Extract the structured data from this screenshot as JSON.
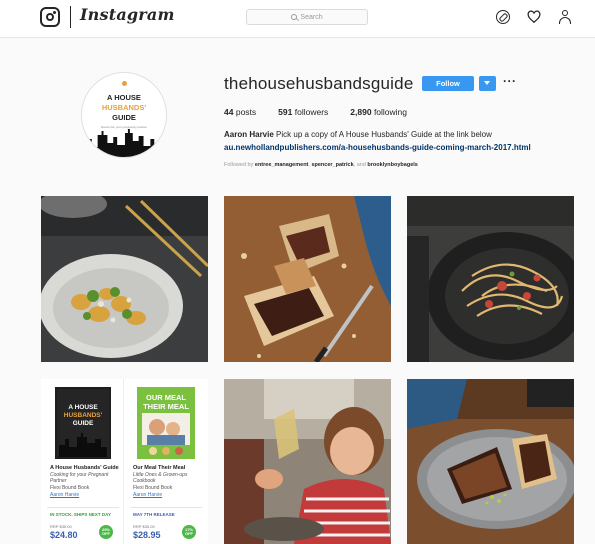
{
  "header": {
    "wordmark": "Instagram",
    "search_placeholder": "Search",
    "icons": [
      "camera-logo-icon",
      "compass-icon",
      "heart-icon",
      "person-icon"
    ]
  },
  "profile": {
    "avatar_text": [
      "A HOUSE",
      "HUSBANDS'",
      "GUIDE"
    ],
    "avatar_small_text": "Dad-to-be: your pregnancy partner",
    "username": "thehousehusbandsguide",
    "follow_label": "Follow",
    "more_label": "···",
    "stats": {
      "posts_count": "44",
      "posts_label": "posts",
      "followers_count": "591",
      "followers_label": "followers",
      "following_count": "2,890",
      "following_label": "following"
    },
    "bio_name": "Aaron Harvie",
    "bio_text": "Pick up a copy of A House Husbands' Guide at the link below",
    "bio_link": "au.newhollandpublishers.com/a-househusbands-guide-coming-march-2017.html",
    "followed_prefix": "Followed by",
    "followed_by": [
      "entree_management",
      "spencer_patrick",
      "brooklynboybagels"
    ],
    "followed_sep": ", ",
    "followed_and": ", and"
  },
  "books": [
    {
      "cover_lines": [
        "A HOUSE",
        "HUSBANDS'",
        "GUIDE"
      ],
      "title": "A House Husbands' Guide",
      "subtitle": "Cooking for your Pregnant Partner",
      "format": "Flexi Bound Book",
      "author": "Aaron Harvie",
      "stock": "IN STOCK. SHIPS NEXT DAY",
      "rrp": "RRP $35.00",
      "price": "$24.80",
      "discount": "29% OFF"
    },
    {
      "cover_lines": [
        "OUR MEAL",
        "THEIR MEAL"
      ],
      "title": "Our Meal Their Meal",
      "subtitle": "Little Ones & Grown-ups Cookbook",
      "format": "Flexi Bound Book",
      "author": "Aaron Harvie",
      "stock": "MAY 7TH RELEASE",
      "rrp": "RRP $35.00",
      "price": "$28.95",
      "discount": "17% OFF"
    }
  ],
  "colors": {
    "accent": "#3897f0",
    "link": "#003569",
    "price": "#3b5fb2",
    "discount": "#4cb848"
  }
}
